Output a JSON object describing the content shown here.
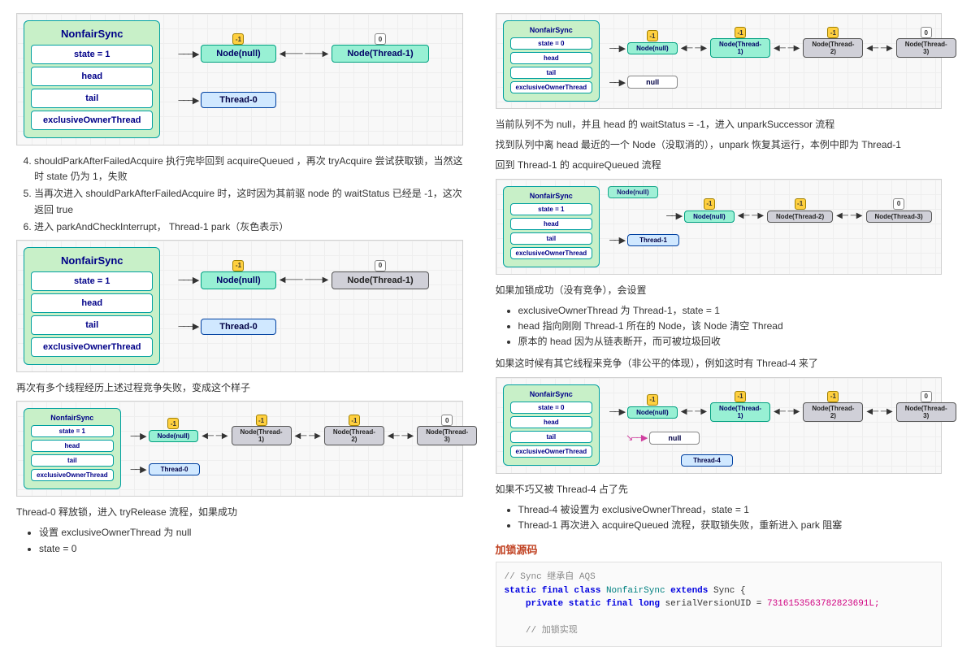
{
  "leftCol": {
    "diag1": {
      "syncTitle": "NonfairSync",
      "fields": [
        "state = 1",
        "head",
        "tail",
        "exclusiveOwnerThread"
      ],
      "nodeNull": "Node(null)",
      "nodeT1": "Node(Thread-1)",
      "thread0": "Thread-0",
      "badgeNeg": "-1",
      "badgeZero": "0"
    },
    "list1": {
      "item4": "shouldParkAfterFailedAcquire 执行完毕回到 acquireQueued ，再次 tryAcquire 尝试获取锁，当然这时 state 仍为 1，失败",
      "item5": "当再次进入 shouldParkAfterFailedAcquire 时，这时因为其前驱 node 的 waitStatus 已经是 -1，这次返回 true",
      "item6": "进入 parkAndCheckInterrupt， Thread-1 park（灰色表示）"
    },
    "diag2": {
      "syncTitle": "NonfairSync",
      "fields": [
        "state = 1",
        "head",
        "tail",
        "exclusiveOwnerThread"
      ],
      "nodeNull": "Node(null)",
      "nodeT1Gray": "Node(Thread-1)",
      "thread0": "Thread-0",
      "badgeNeg": "-1",
      "badgeZero": "0"
    },
    "p_multi": "再次有多个线程经历上述过程竞争失败，变成这个样子",
    "diag3": {
      "syncTitle": "NonfairSync",
      "fields": [
        "state = 1",
        "head",
        "tail",
        "exclusiveOwnerThread"
      ],
      "nodeNull": "Node(null)",
      "nodeT1": "Node(Thread-1)",
      "nodeT2": "Node(Thread-2)",
      "nodeT3": "Node(Thread-3)",
      "thread0": "Thread-0",
      "badgeNeg": "-1",
      "badgeZero": "0"
    },
    "p_release": "Thread-0 释放锁，进入 tryRelease 流程，如果成功",
    "releaseList": {
      "b1": "设置 exclusiveOwnerThread 为 null",
      "b2": "state = 0"
    }
  },
  "rightCol": {
    "diag4": {
      "syncTitle": "NonfairSync",
      "fields": [
        "state = 0",
        "head",
        "tail",
        "exclusiveOwnerThread"
      ],
      "nodeNull": "Node(null)",
      "nodeT1": "Node(Thread-1)",
      "nodeT2": "Node(Thread-2)",
      "nodeT3": "Node(Thread-3)",
      "nullLabel": "null",
      "badgeNeg": "-1",
      "badgeZero": "0"
    },
    "p1": "当前队列不为 null，并且 head 的 waitStatus = -1，进入 unparkSuccessor 流程",
    "p2": "找到队列中离 head 最近的一个 Node（没取消的），unpark 恢复其运行，本例中即为 Thread-1",
    "p3": "回到 Thread-1 的 acquireQueued 流程",
    "diag5": {
      "syncTitle": "NonfairSync",
      "fields": [
        "state = 1",
        "head",
        "tail",
        "exclusiveOwnerThread"
      ],
      "nodeNullTop": "Node(null)",
      "nodeNull": "Node(null)",
      "nodeT2": "Node(Thread-2)",
      "nodeT3": "Node(Thread-3)",
      "thread1": "Thread-1",
      "badgeNeg": "-1",
      "badgeZero": "0"
    },
    "p_lockOk": "如果加锁成功（没有竞争），会设置",
    "lockOkList": {
      "b1": "exclusiveOwnerThread 为 Thread-1，state = 1",
      "b2": "head 指向刚刚 Thread-1 所在的 Node，该 Node 清空 Thread",
      "b3": "原本的 head 因为从链表断开，而可被垃圾回收"
    },
    "p_contest": "如果这时候有其它线程来竞争（非公平的体现），例如这时有 Thread-4 来了",
    "diag6": {
      "syncTitle": "NonfairSync",
      "fields": [
        "state = 0",
        "head",
        "tail",
        "exclusiveOwnerThread"
      ],
      "nodeNull": "Node(null)",
      "nodeT1": "Node(Thread-1)",
      "nodeT2": "Node(Thread-2)",
      "nodeT3": "Node(Thread-3)",
      "nullLabel": "null",
      "thread4": "Thread-4",
      "badgeNeg": "-1",
      "badgeZero": "0"
    },
    "p_t4": "如果不巧又被 Thread-4 占了先",
    "t4List": {
      "b1": "Thread-4 被设置为 exclusiveOwnerThread，state = 1",
      "b2": "Thread-1 再次进入 acquireQueued 流程，获取锁失败，重新进入 park 阻塞"
    },
    "h_src": "加锁源码",
    "code": {
      "c1": "// Sync 继承自 AQS",
      "c2a": "static final class",
      "c2b": "NonfairSync",
      "c2c": "extends",
      "c2d": "Sync {",
      "c3a": "private static final long",
      "c3b": "serialVersionUID =",
      "c3c": "7316153563782823691L;",
      "c4": "// 加锁实现"
    }
  }
}
